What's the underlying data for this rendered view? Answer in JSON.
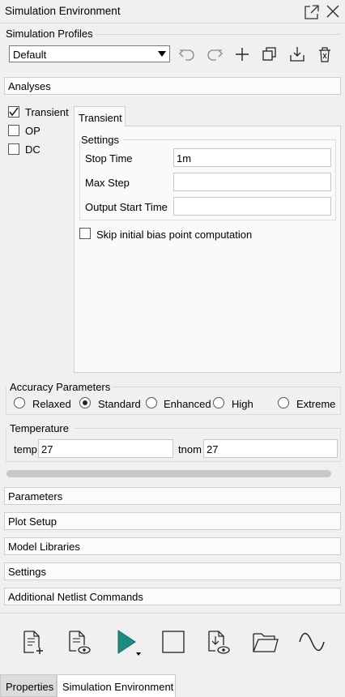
{
  "window": {
    "title": "Simulation Environment"
  },
  "profiles": {
    "label": "Simulation Profiles",
    "selected": "Default"
  },
  "analyses": {
    "label": "Analyses",
    "items": [
      {
        "label": "Transient",
        "checked": true
      },
      {
        "label": "OP",
        "checked": false
      },
      {
        "label": "DC",
        "checked": false
      }
    ],
    "active_tab": "Transient"
  },
  "transient": {
    "settings_label": "Settings",
    "stop_time": {
      "label": "Stop Time",
      "value": "1m"
    },
    "max_step": {
      "label": "Max Step",
      "value": ""
    },
    "output_start": {
      "label": "Output Start Time",
      "value": ""
    },
    "skip_bias": {
      "label": "Skip initial bias point computation",
      "checked": false
    }
  },
  "accuracy": {
    "label": "Accuracy Parameters",
    "options": [
      "Relaxed",
      "Standard",
      "Enhanced",
      "High",
      "Extreme"
    ],
    "selected": "Standard"
  },
  "temperature": {
    "label": "Temperature",
    "temp_label": "temp",
    "temp_value": "27",
    "tnom_label": "tnom",
    "tnom_value": "27"
  },
  "sections": [
    "Parameters",
    "Plot Setup",
    "Model Libraries",
    "Settings",
    "Additional Netlist Commands"
  ],
  "bottom_tabs": [
    "Properties",
    "Simulation Environment"
  ],
  "colors": {
    "run": "#1e8a82",
    "accent": "#0060c0"
  }
}
